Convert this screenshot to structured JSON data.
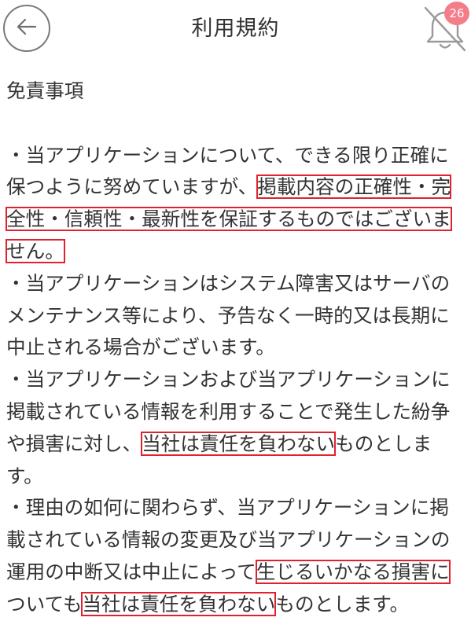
{
  "header": {
    "title": "利用規約",
    "back_icon": "arrow-left-icon",
    "bell_icon": "bell-off-icon",
    "badge_count": "26",
    "badge_color": "#f47d8a"
  },
  "colors": {
    "highlight_border": "#e0222e",
    "text": "#333333"
  },
  "content": {
    "heading": "免責事項",
    "lines": [
      {
        "segments": [
          {
            "t": "・当アプリケーションについて、できる限り正確に",
            "hl": false
          }
        ]
      },
      {
        "segments": [
          {
            "t": "保つように努めていますが、",
            "hl": false
          },
          {
            "t": "掲載内容の正確性・完",
            "hl": true
          }
        ]
      },
      {
        "segments": [
          {
            "t": "全性・信頼性・最新性を保証するものではございま",
            "hl": true
          }
        ]
      },
      {
        "segments": [
          {
            "t": "せん。",
            "hl": true
          }
        ]
      },
      {
        "segments": [
          {
            "t": "・当アプリケーションはシステム障害又はサーバの",
            "hl": false
          }
        ]
      },
      {
        "segments": [
          {
            "t": "メンテナンス等により、予告なく一時的又は長期に",
            "hl": false
          }
        ]
      },
      {
        "segments": [
          {
            "t": "中止される場合がございます。",
            "hl": false
          }
        ]
      },
      {
        "segments": [
          {
            "t": "・当アプリケーションおよび当アプリケーションに",
            "hl": false
          }
        ]
      },
      {
        "segments": [
          {
            "t": "掲載されている情報を利用することで発生した紛争",
            "hl": false
          }
        ]
      },
      {
        "segments": [
          {
            "t": "や損害に対し、",
            "hl": false
          },
          {
            "t": "当社は責任を負わない",
            "hl": true
          },
          {
            "t": "ものとしま",
            "hl": false
          }
        ]
      },
      {
        "segments": [
          {
            "t": "す。",
            "hl": false
          }
        ]
      },
      {
        "segments": [
          {
            "t": "・理由の如何に関わらず、当アプリケーションに掲",
            "hl": false
          }
        ]
      },
      {
        "segments": [
          {
            "t": "載されている情報の変更及び当アプリケーションの",
            "hl": false
          }
        ]
      },
      {
        "segments": [
          {
            "t": "運用の中断又は中止によって",
            "hl": false
          },
          {
            "t": "生じるいかなる損害に",
            "hl": true
          }
        ]
      },
      {
        "segments": [
          {
            "t": "ついても",
            "hl": false
          },
          {
            "t": "当社は責任を負わない",
            "hl": true
          },
          {
            "t": "ものとします。",
            "hl": false
          }
        ]
      }
    ]
  }
}
